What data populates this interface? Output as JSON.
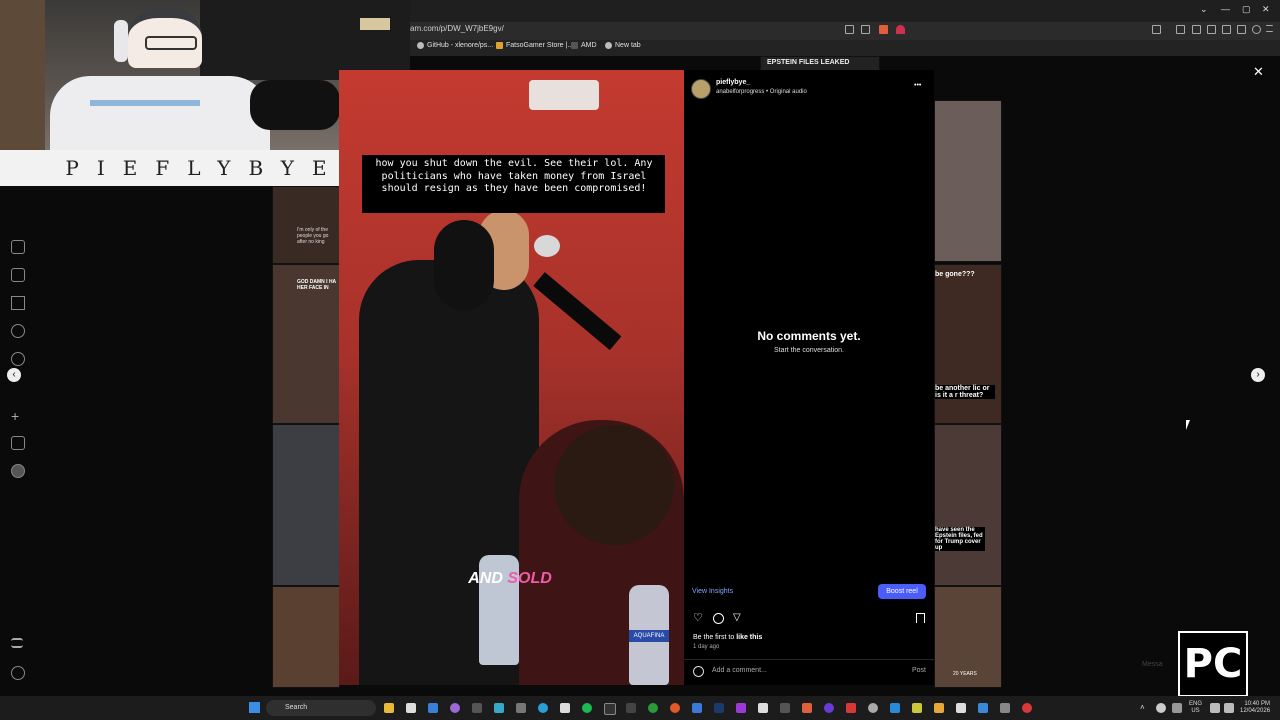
{
  "browser": {
    "url": "am.com/p/DW_W7jbE9gv/",
    "bookmarks": [
      "GitHub - xlenore/ps...",
      "FatsoGamer Store |...",
      "AMD",
      "New tab"
    ],
    "window_controls": [
      "—",
      "▢",
      "✕"
    ]
  },
  "overlay": {
    "banner_text": "PIEFLYBYE",
    "pc_logo": "PC"
  },
  "video": {
    "caption": "how you shut down the evil. See their lol. Any politicians who have taken money from Israel should resign as they have been compromised!",
    "subtitle_word1": "AND",
    "subtitle_word2": "SOLD",
    "bottle_label": "AQUAFINA"
  },
  "post": {
    "username": "pieflybye_",
    "audio": "anabelforprogress • Original audio",
    "more": "•••",
    "no_comments_title": "No comments yet.",
    "no_comments_sub": "Start the conversation.",
    "view_insights": "View Insights",
    "boost_reel": "Boost reel",
    "likes_text_prefix": "Be the first to ",
    "likes_text_link": "like this",
    "time_ago": "1 day ago",
    "comment_placeholder": "Add a comment...",
    "post_button": "Post"
  },
  "nav": {
    "close": "✕",
    "prev": "‹",
    "next": "›"
  },
  "bg_tiles_text": {
    "epstein": "EPSTEIN FILES LEAKED",
    "gone": "be gone???",
    "another": "be another lic or is it a r threat?",
    "seen": "have seen the Epstein files, fed for Trump cover up",
    "only": "I'm only of the people you go after no king",
    "god": "GOD DAMN I HA HER FACE IN",
    "years": "20 YEARS"
  },
  "taskbar": {
    "search": "Search",
    "lang1": "ENG",
    "lang2": "US",
    "time": "10:40 PM",
    "date": "12/04/2026",
    "message": "Messa"
  }
}
